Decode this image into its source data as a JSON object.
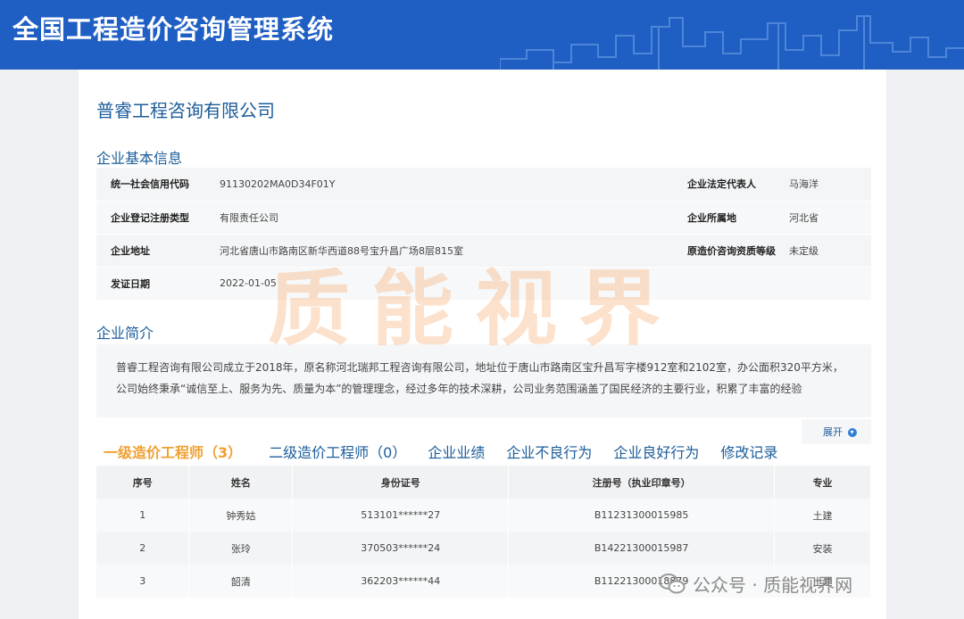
{
  "header": {
    "title": "全国工程造价咨询管理系统"
  },
  "company": {
    "name": "普睿工程咨询有限公司"
  },
  "basic_info": {
    "title": "企业基本信息",
    "rows": [
      {
        "label1": "统一社会信用代码",
        "value1": "91130202MA0D34F01Y",
        "label2": "企业法定代表人",
        "value2": "马海洋"
      },
      {
        "label1": "企业登记注册类型",
        "value1": "有限责任公司",
        "label2": "企业所属地",
        "value2": "河北省"
      },
      {
        "label1": "企业地址",
        "value1": "河北省唐山市路南区新华西道88号宝升昌广场8层815室",
        "label2": "原造价咨询资质等级",
        "value2": "未定级"
      },
      {
        "label1": "发证日期",
        "value1": "2022-01-05",
        "label2": "",
        "value2": ""
      }
    ]
  },
  "intro": {
    "title": "企业简介",
    "text": "普睿工程咨询有限公司成立于2018年，原名称河北瑞邦工程咨询有限公司，地址位于唐山市路南区宝升昌写字楼912室和2102室，办公面积320平方米，公司始终秉承“诚信至上、服务为先、质量为本”的管理理念，经过多年的技术深耕，公司业务范围涵盖了国民经济的主要行业，积累了丰富的经验",
    "expand_label": "展开",
    "expand_icon": "chevron-down-circle-icon"
  },
  "tabs": [
    {
      "label": "一级造价工程师（3）"
    },
    {
      "label": "二级造价工程师（0）"
    },
    {
      "label": "企业业绩"
    },
    {
      "label": "企业不良行为"
    },
    {
      "label": "企业良好行为"
    },
    {
      "label": "修改记录"
    }
  ],
  "engineers": {
    "columns": [
      "序号",
      "姓名",
      "身份证号",
      "注册号（执业印章号）",
      "专业"
    ],
    "rows": [
      [
        "1",
        "钟秀姑",
        "513101******27",
        "B11231300015985",
        "土建"
      ],
      [
        "2",
        "张玲",
        "370503******24",
        "B14221300015987",
        "安装"
      ],
      [
        "3",
        "韶清",
        "362203******44",
        "B11221300018879",
        "土建"
      ]
    ]
  },
  "watermark": {
    "text": "质能视界"
  },
  "wechat": {
    "label": "公众号 · 质能视界网",
    "icon": "wechat-icon"
  },
  "colors": {
    "header": "#1f5fc4",
    "accent": "#1c5d9a",
    "active_tab": "#f0a030"
  }
}
